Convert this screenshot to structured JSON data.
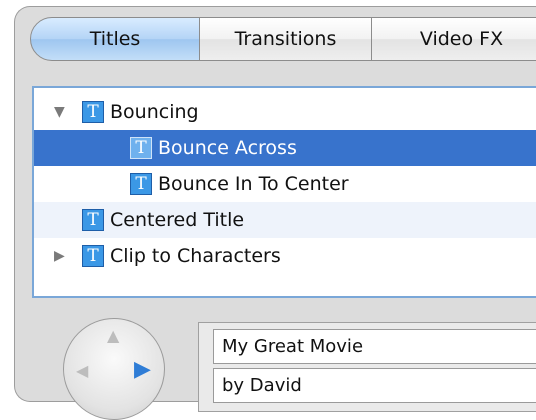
{
  "tabs": [
    {
      "label": "Titles",
      "selected": true
    },
    {
      "label": "Transitions",
      "selected": false
    },
    {
      "label": "Video FX",
      "selected": false
    }
  ],
  "title_list": [
    {
      "label": "Bouncing",
      "type": "group",
      "expanded": true,
      "icon": "title-t-icon"
    },
    {
      "label": "Bounce Across",
      "type": "item",
      "selected": true,
      "icon": "title-t-icon"
    },
    {
      "label": "Bounce In To Center",
      "type": "item",
      "selected": false,
      "icon": "title-t-icon"
    },
    {
      "label": "Centered Title",
      "type": "item",
      "selected": false,
      "icon": "title-t-icon"
    },
    {
      "label": "Clip to Characters",
      "type": "group",
      "expanded": false,
      "icon": "title-t-icon"
    }
  ],
  "icon_glyph": "T",
  "direction_pad": {
    "active_direction": "right"
  },
  "text_fields": [
    {
      "value": "My Great Movie"
    },
    {
      "value": "by David"
    }
  ],
  "colors": {
    "selection": "#3873cc",
    "title_icon": "#3b98e6",
    "active_tab": "#b4d4f6"
  }
}
